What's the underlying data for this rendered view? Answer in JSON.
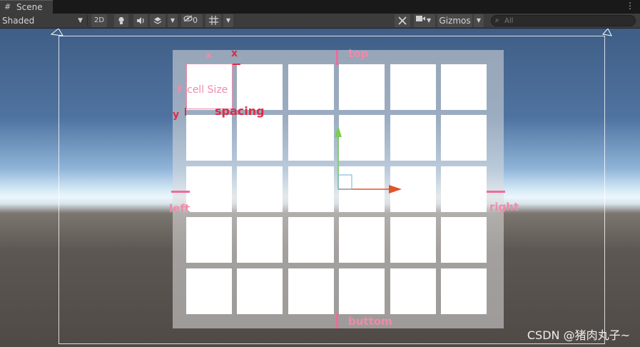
{
  "tab": {
    "icon": "scene-grid-icon",
    "label": "Scene",
    "menu_icon": "kebab-icon"
  },
  "toolbar": {
    "shading_mode": "Shaded",
    "mode_2d": "2D",
    "hidden_count": "0",
    "gizmos_label": "Gizmos",
    "search_placeholder": "All",
    "icons": [
      "lightbulb-icon",
      "audio-icon",
      "effects-icon",
      "visibility-icon",
      "grid-icon",
      "tools-icon",
      "camera-icon"
    ]
  },
  "annotations": {
    "top": "top",
    "bottom": "buttom",
    "left": "left",
    "right": "right",
    "cell_size": "cell Size",
    "cell_x": "x",
    "cell_y": "y",
    "spacing": "spacing",
    "spacing_x": "x",
    "spacing_y": "y"
  },
  "grid": {
    "rows": 5,
    "columns": 6
  },
  "colors": {
    "annotation_pink": "#f08aa8",
    "annotation_red": "#e02a44",
    "x_axis": "#e0552a",
    "y_axis": "#7ccc55"
  },
  "watermark": "CSDN @猪肉丸子~"
}
